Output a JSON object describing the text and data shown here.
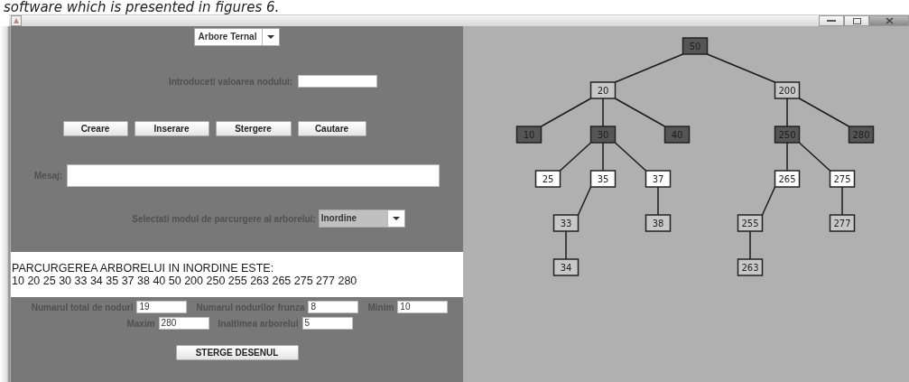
{
  "caption": "software which is presented in figures 6.",
  "tree_type": {
    "value": "Arbore Ternal"
  },
  "node_value": {
    "label": "Introduceti valoarea nodului:"
  },
  "buttons": [
    "Creare",
    "Inserare",
    "Stergere",
    "Cautare"
  ],
  "message": {
    "label": "Mesaj:"
  },
  "traversal": {
    "label": "Selectati modul de parcurgere al arborelui:",
    "value": "Inordine"
  },
  "output": {
    "heading": "PARCURGEREA ARBORELUI IN INORDINE ESTE:",
    "sequence": "10 20 25 30 33 34 35 37 38 40 50 200 250 255 263 265 275 277 280"
  },
  "stats_rows": [
    [
      {
        "label": "Numarul total de noduri",
        "value": "19"
      },
      {
        "label": "Numarul nodurilor frunza",
        "value": "8"
      },
      {
        "label": "Minim",
        "value": "10"
      }
    ],
    [
      {
        "label": "Maxim",
        "value": "280"
      },
      {
        "label": "Inaltimea arborelui",
        "value": "5"
      }
    ]
  ],
  "clear_button": "STERGE DESENUL",
  "tree": {
    "value": "50",
    "color": "#555555",
    "children": [
      {
        "kind": "left",
        "value": "20",
        "color": "#c8c8c8",
        "children": [
          {
            "kind": "left",
            "value": "10",
            "color": "#555555"
          },
          {
            "kind": "middle",
            "value": "30",
            "color": "#555555",
            "children": [
              {
                "kind": "left",
                "value": "25",
                "color": "#ffffff"
              },
              {
                "kind": "middle",
                "value": "35",
                "color": "#ffffff",
                "children": [
                  {
                    "kind": "left",
                    "value": "33",
                    "color": "#c8c8c8",
                    "children": [
                      {
                        "kind": "middle",
                        "value": "34",
                        "color": "#c8c8c8"
                      }
                    ]
                  }
                ]
              },
              {
                "kind": "right",
                "value": "37",
                "color": "#ffffff",
                "children": [
                  {
                    "kind": "middle",
                    "value": "38",
                    "color": "#c8c8c8"
                  }
                ]
              }
            ]
          },
          {
            "kind": "right",
            "value": "40",
            "color": "#555555"
          }
        ]
      },
      {
        "kind": "right",
        "value": "200",
        "color": "#c8c8c8",
        "children": [
          {
            "kind": "middle",
            "value": "250",
            "color": "#555555",
            "children": [
              {
                "kind": "middle",
                "value": "265",
                "color": "#ffffff",
                "children": [
                  {
                    "kind": "left",
                    "value": "255",
                    "color": "#c8c8c8",
                    "children": [
                      {
                        "kind": "middle",
                        "value": "263",
                        "color": "#c8c8c8"
                      }
                    ]
                  }
                ]
              },
              {
                "kind": "right",
                "value": "275",
                "color": "#ffffff",
                "children": [
                  {
                    "kind": "middle",
                    "value": "277",
                    "color": "#c8c8c8"
                  }
                ]
              }
            ]
          },
          {
            "kind": "right",
            "value": "280",
            "color": "#555555"
          }
        ]
      }
    ]
  }
}
